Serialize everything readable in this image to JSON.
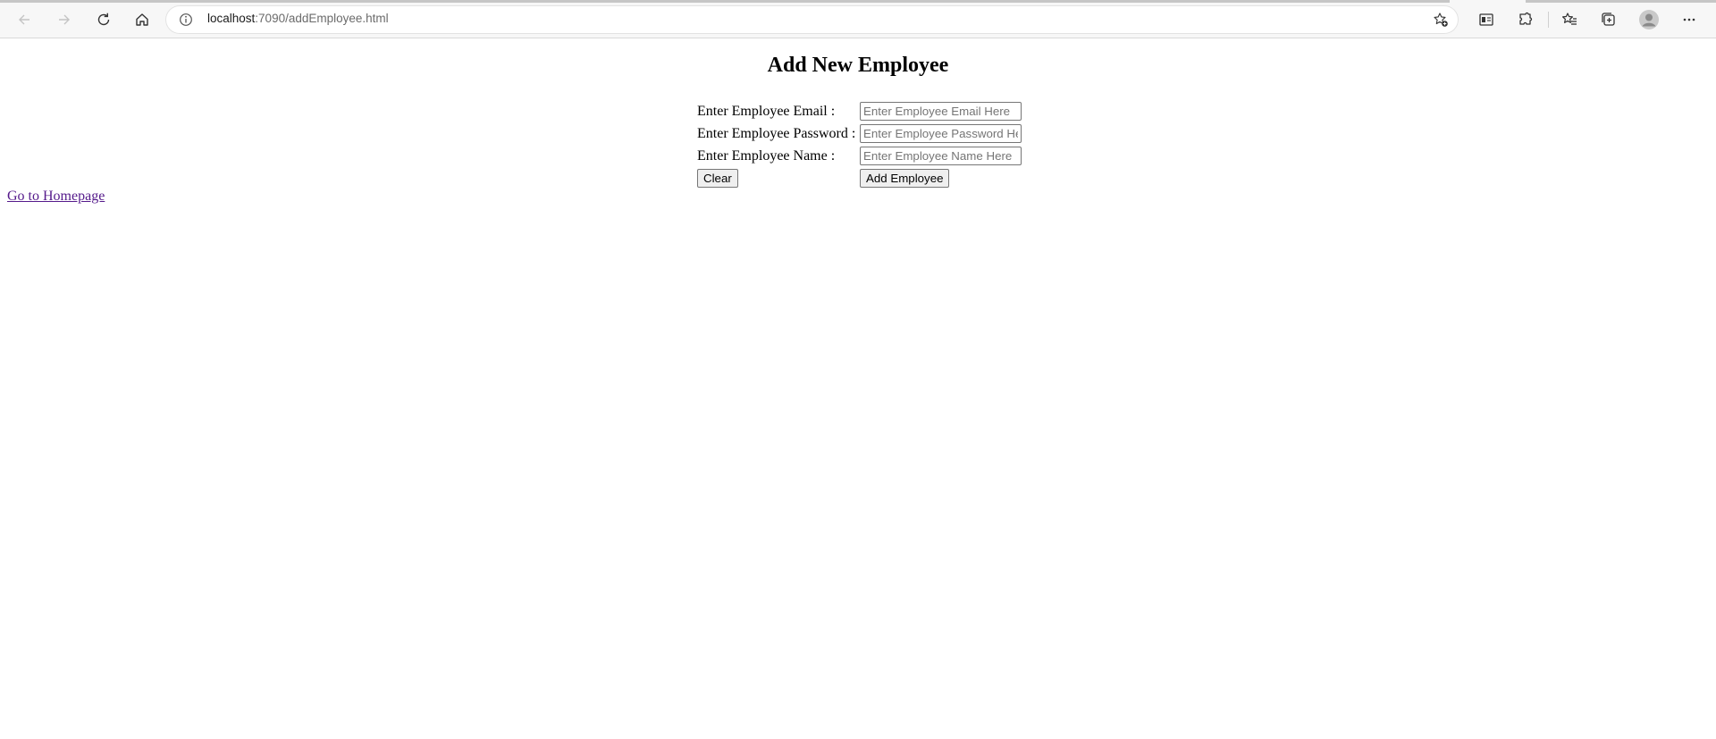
{
  "browser": {
    "url_host": "localhost",
    "url_path": ":7090/addEmployee.html"
  },
  "page": {
    "title": "Add New Employee",
    "form": {
      "email_label": "Enter Employee Email :",
      "email_placeholder": "Enter Employee Email Here",
      "email_value": "",
      "password_label": "Enter Employee Password :",
      "password_placeholder": "Enter Employee Password Here",
      "password_value": "",
      "name_label": "Enter Employee Name :",
      "name_placeholder": "Enter Employee Name Here",
      "name_value": "",
      "clear_button": "Clear",
      "submit_button": "Add Employee"
    },
    "home_link": "Go to Homepage"
  },
  "icons": {
    "back": "back-arrow-icon",
    "forward": "forward-arrow-icon",
    "refresh": "refresh-icon",
    "home": "home-icon",
    "site_info": "info-icon",
    "add_favorite": "add-favorite-icon",
    "immersive_reader": "reader-view-icon",
    "extensions": "extensions-icon",
    "favorites": "favorites-icon",
    "collections": "collections-icon",
    "profile": "profile-avatar",
    "menu": "more-menu-icon"
  },
  "colors": {
    "link_visited": "#551a8b",
    "chrome_bg": "#f7f7f7"
  }
}
